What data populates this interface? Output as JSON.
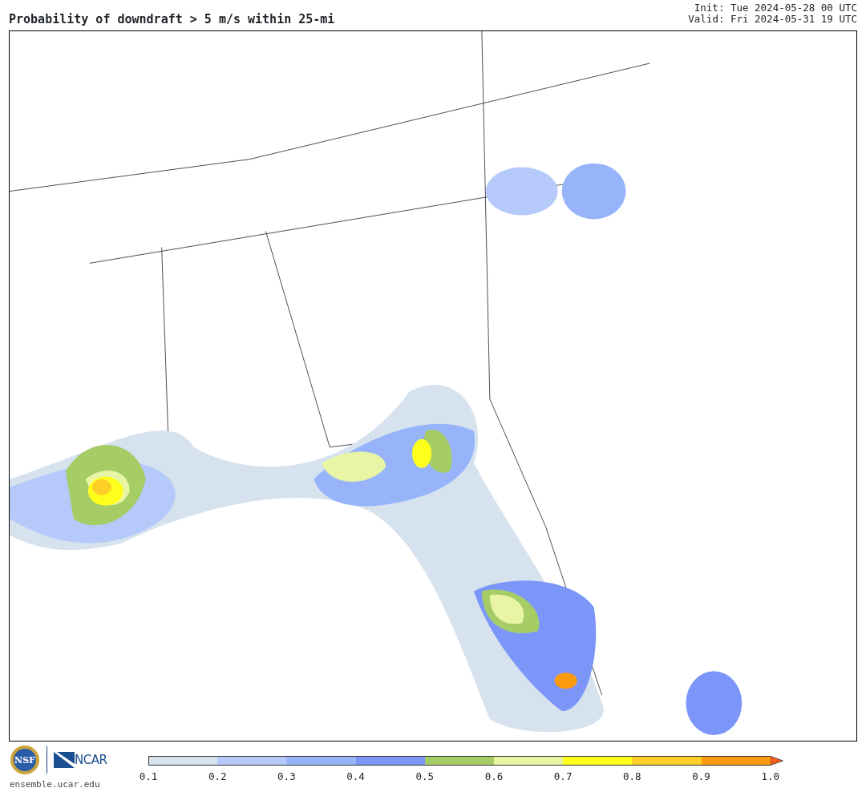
{
  "header": {
    "title": "Probability of downdraft > 5 m/s within 25-mi",
    "init": "Init: Tue 2024-05-28 00 UTC",
    "valid": "Valid: Fri 2024-05-31 19 UTC"
  },
  "footer": {
    "seal_text": "NSF",
    "logo_text": "NCAR",
    "site": "ensemble.ucar.edu"
  },
  "colorbar": {
    "bins": [
      {
        "color": "#d6e2ee"
      },
      {
        "color": "#b5c9fb"
      },
      {
        "color": "#97b4fb"
      },
      {
        "color": "#7b96f8"
      },
      {
        "color": "#a6cc66"
      },
      {
        "color": "#e8f5a4"
      },
      {
        "color": "#ffff1c"
      },
      {
        "color": "#fdd027"
      },
      {
        "color": "#fd9b0f"
      }
    ],
    "arrow": {
      "color": "#f65c1a"
    },
    "ticks": [
      "0.1",
      "0.2",
      "0.3",
      "0.4",
      "0.5",
      "0.6",
      "0.7",
      "0.8",
      "0.9",
      "1.0"
    ]
  }
}
